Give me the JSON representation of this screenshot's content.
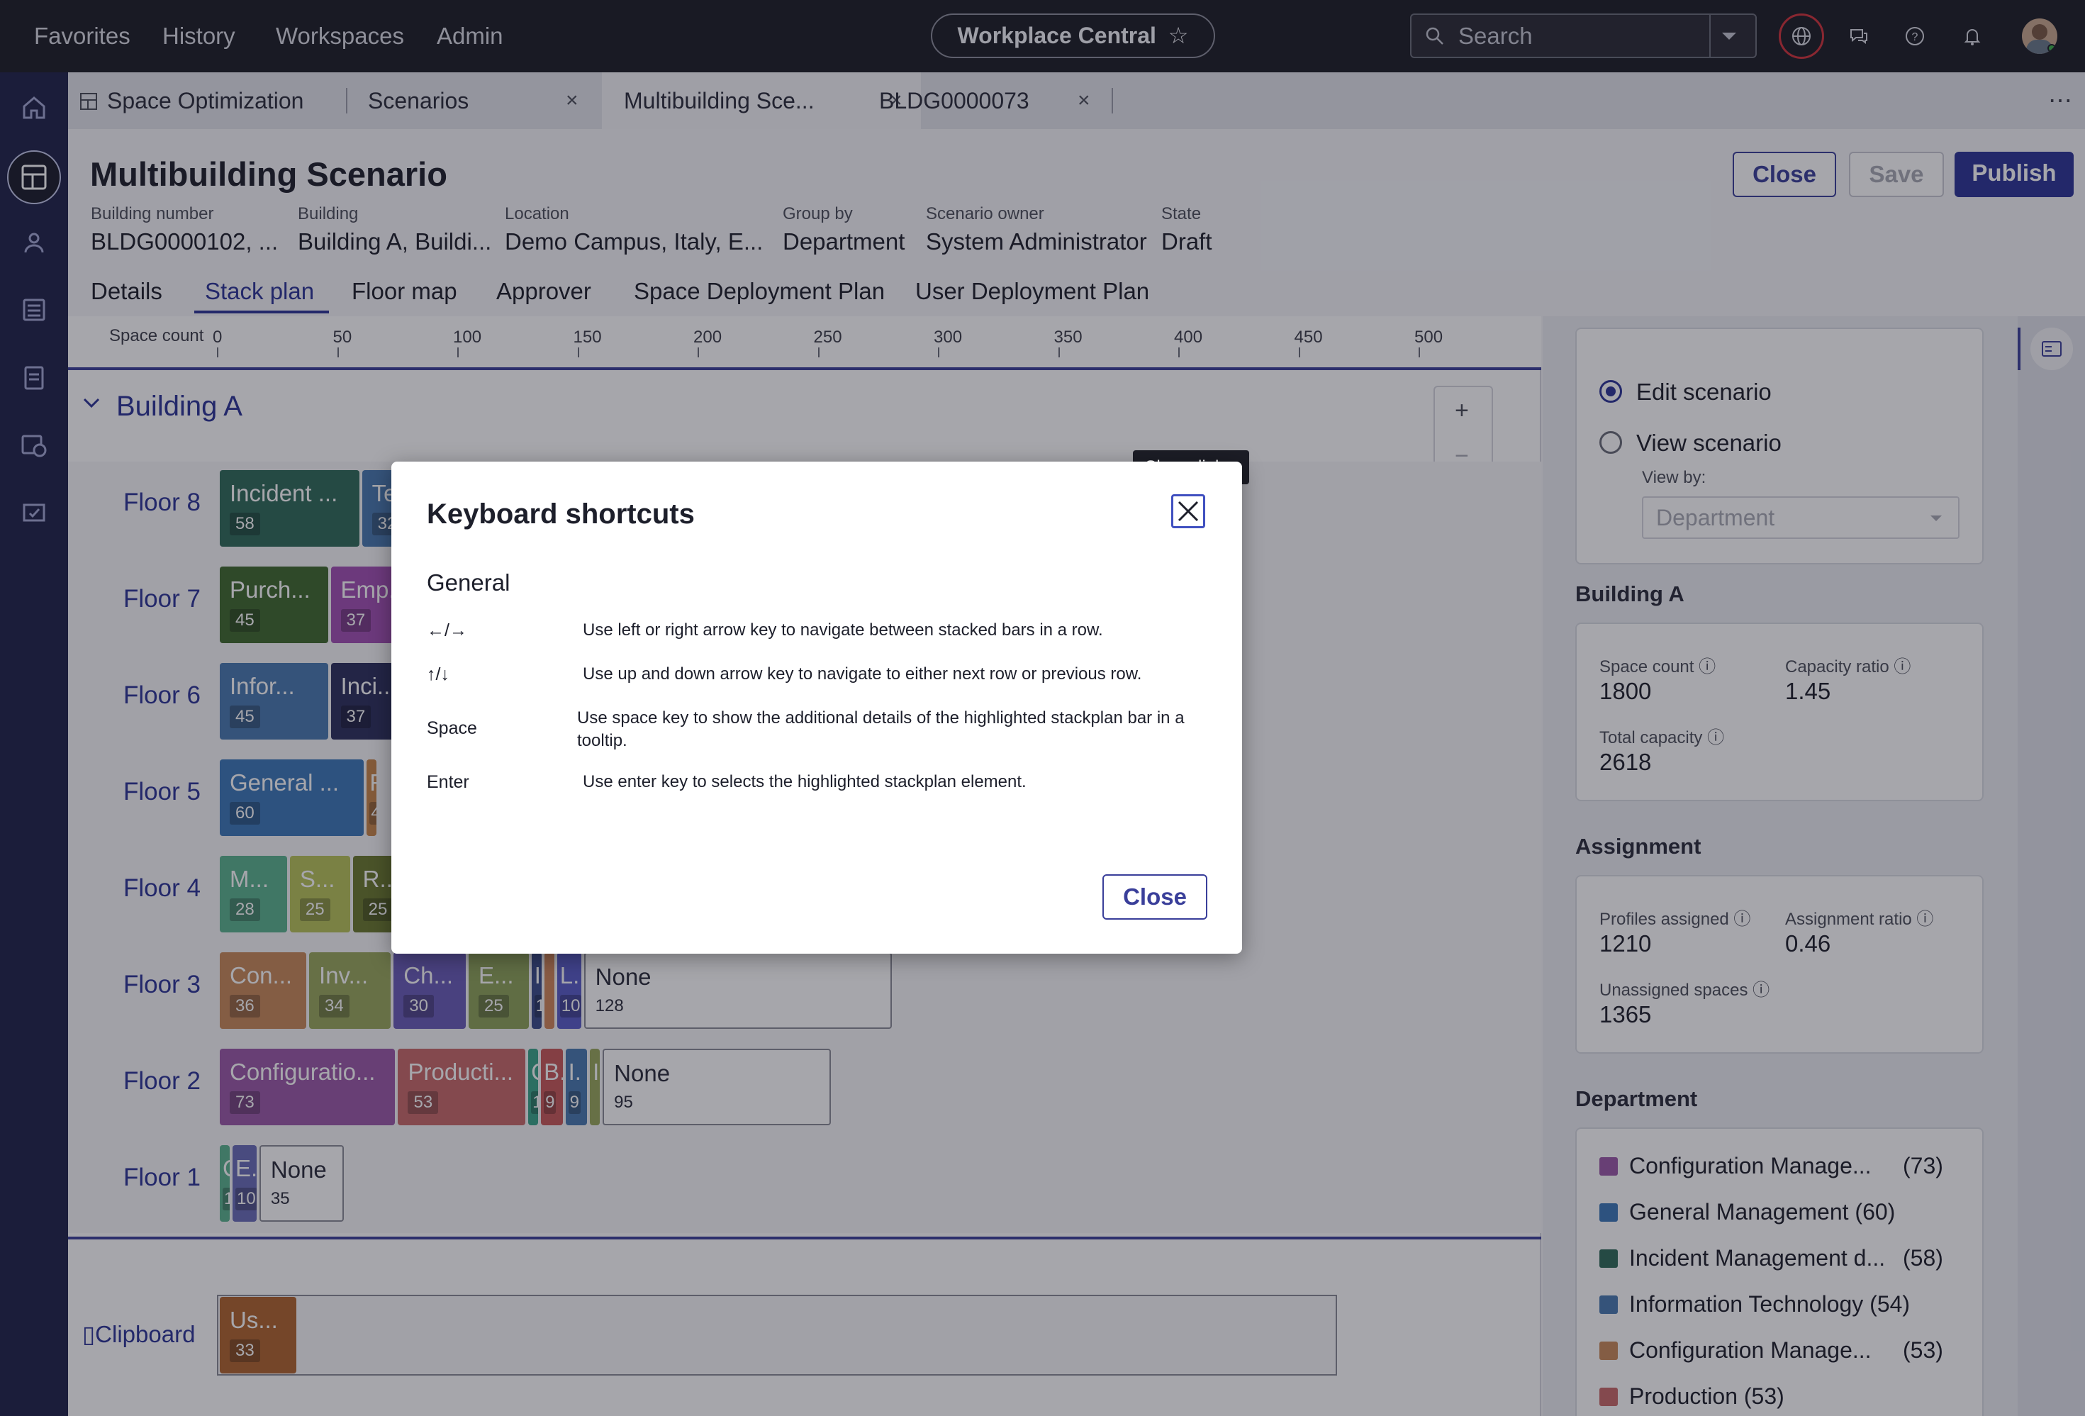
{
  "topbar": {
    "nav": [
      "Favorites",
      "History",
      "Workspaces",
      "Admin"
    ],
    "app_title": "Workplace Central",
    "search_placeholder": "Search"
  },
  "tabs": [
    {
      "label": "Space Optimization",
      "closable": false
    },
    {
      "label": "Scenarios",
      "closable": true
    },
    {
      "label": "Multibuilding Sce...",
      "closable": true,
      "active": true
    },
    {
      "label": "BLDG0000073",
      "closable": true
    }
  ],
  "header": {
    "title": "Multibuilding Scenario",
    "buttons": {
      "close": "Close",
      "save": "Save",
      "publish": "Publish"
    },
    "meta": [
      {
        "label": "Building number",
        "value": "BLDG0000102, ..."
      },
      {
        "label": "Building",
        "value": "Building A, Buildi..."
      },
      {
        "label": "Location",
        "value": "Demo Campus, Italy, E..."
      },
      {
        "label": "Group by",
        "value": "Department"
      },
      {
        "label": "Scenario owner",
        "value": "System Administrator"
      },
      {
        "label": "State",
        "value": "Draft"
      }
    ],
    "subtabs": [
      "Details",
      "Stack plan",
      "Floor map",
      "Approver",
      "Space Deployment Plan",
      "User Deployment Plan"
    ],
    "active_subtab": "Stack plan"
  },
  "axis": {
    "label": "Space count",
    "ticks": [
      "0",
      "50",
      "100",
      "150",
      "200",
      "250",
      "300",
      "350",
      "400",
      "450",
      "500"
    ]
  },
  "building": {
    "name": "Building A",
    "floors": [
      {
        "name": "Floor 8",
        "bars": [
          {
            "label": "Incident ...",
            "value": "58",
            "color": "#2f6b5a"
          },
          {
            "label": "Te",
            "value": "32",
            "color": "#4a7ab0"
          }
        ]
      },
      {
        "name": "Floor 7",
        "bars": [
          {
            "label": "Purch...",
            "value": "45",
            "color": "#3f6a2e"
          },
          {
            "label": "Emp...",
            "value": "37",
            "color": "#a24fb3"
          }
        ]
      },
      {
        "name": "Floor 6",
        "bars": [
          {
            "label": "Infor...",
            "value": "45",
            "color": "#4a7ab0"
          },
          {
            "label": "Inci...",
            "value": "37",
            "color": "#2c2f5c"
          }
        ]
      },
      {
        "name": "Floor 5",
        "bars": [
          {
            "label": "General ...",
            "value": "60",
            "color": "#3d78b8"
          },
          {
            "label": "R",
            "value": "4",
            "color": "#c8864a"
          }
        ]
      },
      {
        "name": "Floor 4",
        "bars": [
          {
            "label": "M...",
            "value": "28",
            "color": "#5bb38f"
          },
          {
            "label": "S...",
            "value": "25",
            "color": "#b9c45a"
          },
          {
            "label": "R...",
            "value": "25",
            "color": "#6b7a2e"
          }
        ]
      },
      {
        "name": "Floor 3",
        "bars": [
          {
            "label": "Con...",
            "value": "36",
            "color": "#c98a5a"
          },
          {
            "label": "Inv...",
            "value": "34",
            "color": "#9aa85c"
          },
          {
            "label": "Ch...",
            "value": "30",
            "color": "#6a5cb8"
          },
          {
            "label": "E...",
            "value": "25",
            "color": "#8ea35a"
          },
          {
            "label": "I.",
            "value": "1",
            "color": "#3a4d8a"
          },
          {
            "label": "",
            "value": "",
            "color": "#d0875a"
          },
          {
            "label": "L.",
            "value": "10",
            "color": "#5a5cc8"
          },
          {
            "label": "None",
            "value": "128",
            "color": "none"
          }
        ]
      },
      {
        "name": "Floor 2",
        "bars": [
          {
            "label": "Configuratio...",
            "value": "73",
            "color": "#9b5aa8"
          },
          {
            "label": "Producti...",
            "value": "53",
            "color": "#c96a6a"
          },
          {
            "label": "C",
            "value": "1",
            "color": "#3aa58a"
          },
          {
            "label": "B.",
            "value": "9",
            "color": "#c85a5a"
          },
          {
            "label": "I.",
            "value": "9",
            "color": "#4a7ab0"
          },
          {
            "label": "I",
            "value": "",
            "color": "#9aa85c"
          },
          {
            "label": "None",
            "value": "95",
            "color": "none"
          }
        ]
      },
      {
        "name": "Floor 1",
        "bars": [
          {
            "label": "C",
            "value": "1",
            "color": "#5bb38f"
          },
          {
            "label": "E.",
            "value": "10",
            "color": "#6a6cb8"
          },
          {
            "label": "None",
            "value": "35",
            "color": "none"
          }
        ]
      }
    ],
    "clipboard": {
      "label": "Clipboard",
      "bar": {
        "label": "Us...",
        "value": "33",
        "color": "#b0652e"
      }
    }
  },
  "right_panel": {
    "edit_scenario": "Edit scenario",
    "view_scenario": "View scenario",
    "view_by_label": "View by:",
    "view_by_value": "Department",
    "building_title": "Building A",
    "building_stats": [
      {
        "label": "Space count",
        "value": "1800"
      },
      {
        "label": "Capacity ratio",
        "value": "1.45"
      },
      {
        "label": "Total capacity",
        "value": "2618"
      }
    ],
    "assignment_title": "Assignment",
    "assignment_stats": [
      {
        "label": "Profiles assigned",
        "value": "1210"
      },
      {
        "label": "Assignment ratio",
        "value": "0.46"
      },
      {
        "label": "Unassigned spaces",
        "value": "1365"
      }
    ],
    "department_title": "Department",
    "departments": [
      {
        "label": "Configuration Manage...",
        "count": "(73)",
        "color": "#9b5aa8"
      },
      {
        "label": "General Management (60)",
        "count": "",
        "color": "#3d78b8"
      },
      {
        "label": "Incident Management d...",
        "count": "(58)",
        "color": "#2f6b5a"
      },
      {
        "label": "Information Technology (54)",
        "count": "",
        "color": "#4a7ab0"
      },
      {
        "label": "Configuration Manage...",
        "count": "(53)",
        "color": "#c98a5a"
      },
      {
        "label": "Production (53)",
        "count": "",
        "color": "#c96a6a"
      }
    ]
  },
  "dialog": {
    "title": "Keyboard shortcuts",
    "section": "General",
    "close_tooltip": "Close dialog",
    "close_label": "Close",
    "shortcuts": [
      {
        "key": "←/→",
        "desc": "Use left or right arrow key to navigate between stacked bars in a row."
      },
      {
        "key": "↑/↓",
        "desc": "Use up and down arrow key to navigate to either next row or previous row."
      },
      {
        "key": "Space",
        "desc": "Use space key to show the additional details of the highlighted stackplan bar in a tooltip."
      },
      {
        "key": "Enter",
        "desc": "Use enter key to selects the highlighted stackplan element."
      }
    ]
  }
}
